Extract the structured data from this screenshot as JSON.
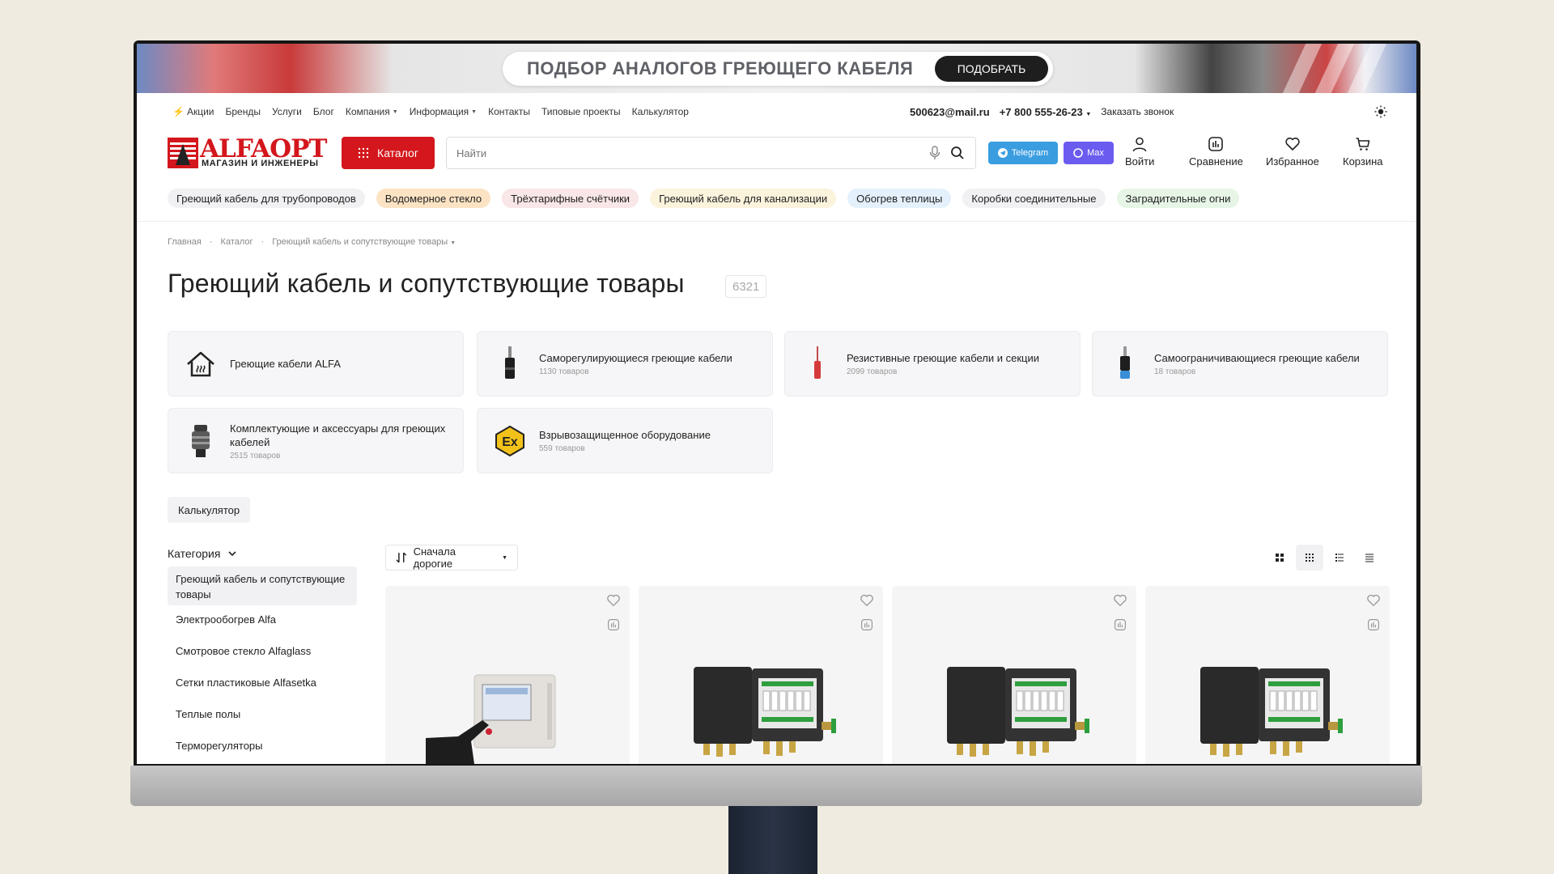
{
  "banner": {
    "text": "ПОДБОР АНАЛОГОВ ГРЕЮЩЕГО КАБЕЛЯ",
    "button": "ПОДОБРАТЬ"
  },
  "topnav": {
    "items": [
      {
        "label": "Акции",
        "icon": "lightning-icon",
        "caret": false
      },
      {
        "label": "Бренды",
        "caret": false
      },
      {
        "label": "Услуги",
        "caret": false
      },
      {
        "label": "Блог",
        "caret": false
      },
      {
        "label": "Компания",
        "caret": true
      },
      {
        "label": "Информация",
        "caret": true
      },
      {
        "label": "Контакты",
        "caret": false
      },
      {
        "label": "Типовые проекты",
        "caret": false
      },
      {
        "label": "Калькулятор",
        "caret": false
      }
    ],
    "email": "500623@mail.ru",
    "phone": "+7 800 555-26-23",
    "callback": "Заказать звонок"
  },
  "header": {
    "logo_name": "ALFAOPT",
    "logo_sub": "МАГАЗИН И ИНЖЕНЕРЫ",
    "catalog_label": "Каталог",
    "search_placeholder": "Найти",
    "telegram_label": "Telegram",
    "max_label": "Max",
    "login_label": "Войти",
    "compare_label": "Сравнение",
    "favorites_label": "Избранное",
    "cart_label": "Корзина"
  },
  "tags": [
    {
      "label": "Греющий кабель для трубопроводов",
      "color": "#f1f1f3"
    },
    {
      "label": "Водомерное стекло",
      "color": "#fbe3c4"
    },
    {
      "label": "Трёхтарифные счётчики",
      "color": "#f9e6e6"
    },
    {
      "label": "Греющий кабель для канализации",
      "color": "#fbf3dc"
    },
    {
      "label": "Обогрев теплицы",
      "color": "#e4f0fb"
    },
    {
      "label": "Коробки соединительные",
      "color": "#f1f1f3"
    },
    {
      "label": "Заградительные огни",
      "color": "#e6f5e6"
    }
  ],
  "breadcrumbs": [
    "Главная",
    "Каталог",
    "Греющий кабель и сопутствующие товары"
  ],
  "page_title": "Греющий кабель и сопутствующие товары",
  "page_count": "6321",
  "categories": [
    {
      "title": "Греющие кабели ALFA",
      "count": "",
      "icon": "house-heating-icon"
    },
    {
      "title": "Саморегулирующиеся греющие кабели",
      "count": "1130 товаров",
      "icon": "cable-black-icon"
    },
    {
      "title": "Резистивные греющие кабели и секции",
      "count": "2099 товаров",
      "icon": "cable-red-icon"
    },
    {
      "title": "Самоограничивающиеся греющие кабели",
      "count": "18 товаров",
      "icon": "cable-blue-icon"
    },
    {
      "title": "Комплектующие и аксессуары для греющих кабелей",
      "count": "2515 товаров",
      "icon": "connector-icon"
    },
    {
      "title": "Взрывозащищенное оборудование",
      "count": "559 товаров",
      "icon": "ex-icon"
    }
  ],
  "calculator_button": "Калькулятор",
  "sidebar": {
    "heading": "Категория",
    "items": [
      "Греющий кабель и сопутствующие товары",
      "Электрообогрев Alfa",
      "Смотровое стекло Alfaglass",
      "Сетки пластиковые Alfasetka",
      "Теплые полы",
      "Терморегуляторы"
    ]
  },
  "sort": {
    "label": "Сначала дорогие"
  },
  "products": [
    {
      "image": "control-panel-image"
    },
    {
      "image": "junction-box-image"
    },
    {
      "image": "junction-box-image"
    },
    {
      "image": "junction-box-image"
    }
  ],
  "colors": {
    "accent": "#d3171c",
    "telegram": "#3a9de0",
    "max": "#6b5cf0"
  }
}
